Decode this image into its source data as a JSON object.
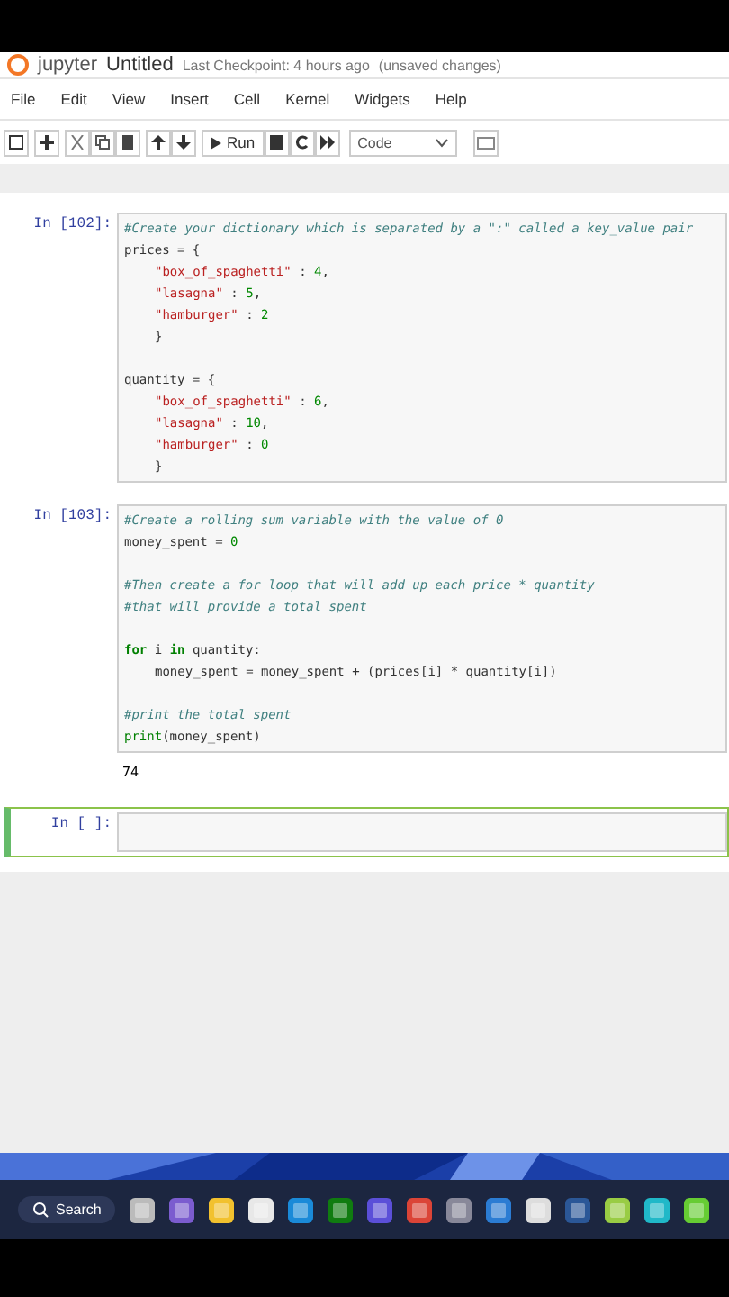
{
  "header": {
    "logo": "jupyter",
    "notebook_name": "Untitled",
    "checkpoint": "Last Checkpoint: 4 hours ago",
    "status": "(unsaved changes)"
  },
  "menu": [
    "File",
    "Edit",
    "View",
    "Insert",
    "Cell",
    "Kernel",
    "Widgets",
    "Help"
  ],
  "toolbar": {
    "run_label": "Run",
    "cell_type": "Code"
  },
  "cells": [
    {
      "prompt": "In [102]:",
      "selected": false,
      "lines": [
        {
          "kind": "code",
          "indent": false,
          "segments": [
            {
              "kind": "comment",
              "text": "#Create your dictionary which is separated by a \":\" called a key_value pair"
            }
          ]
        },
        {
          "kind": "code",
          "indent": false,
          "segments": [
            {
              "kind": "plain",
              "text": "prices = {"
            }
          ]
        },
        {
          "kind": "code",
          "indent": true,
          "segments": [
            {
              "kind": "string",
              "text": "\"box_of_spaghetti\""
            },
            {
              "kind": "plain",
              "text": " : "
            },
            {
              "kind": "number",
              "text": "4"
            },
            {
              "kind": "plain",
              "text": ","
            }
          ]
        },
        {
          "kind": "code",
          "indent": true,
          "segments": [
            {
              "kind": "string",
              "text": "\"lasagna\""
            },
            {
              "kind": "plain",
              "text": " : "
            },
            {
              "kind": "number",
              "text": "5"
            },
            {
              "kind": "plain",
              "text": ","
            }
          ]
        },
        {
          "kind": "code",
          "indent": true,
          "segments": [
            {
              "kind": "string",
              "text": "\"hamburger\""
            },
            {
              "kind": "plain",
              "text": " : "
            },
            {
              "kind": "number",
              "text": "2"
            }
          ]
        },
        {
          "kind": "code",
          "indent": true,
          "segments": [
            {
              "kind": "plain",
              "text": "}"
            }
          ]
        },
        {
          "kind": "blank"
        },
        {
          "kind": "code",
          "indent": false,
          "segments": [
            {
              "kind": "plain",
              "text": "quantity = {"
            }
          ]
        },
        {
          "kind": "code",
          "indent": true,
          "segments": [
            {
              "kind": "string",
              "text": "\"box_of_spaghetti\""
            },
            {
              "kind": "plain",
              "text": " : "
            },
            {
              "kind": "number",
              "text": "6"
            },
            {
              "kind": "plain",
              "text": ","
            }
          ]
        },
        {
          "kind": "code",
          "indent": true,
          "segments": [
            {
              "kind": "string",
              "text": "\"lasagna\""
            },
            {
              "kind": "plain",
              "text": " : "
            },
            {
              "kind": "number",
              "text": "10"
            },
            {
              "kind": "plain",
              "text": ","
            }
          ]
        },
        {
          "kind": "code",
          "indent": true,
          "segments": [
            {
              "kind": "string",
              "text": "\"hamburger\""
            },
            {
              "kind": "plain",
              "text": " : "
            },
            {
              "kind": "number",
              "text": "0"
            }
          ]
        },
        {
          "kind": "code",
          "indent": true,
          "segments": [
            {
              "kind": "plain",
              "text": "}"
            }
          ]
        }
      ]
    },
    {
      "prompt": "In [103]:",
      "selected": false,
      "lines": [
        {
          "kind": "code",
          "indent": false,
          "segments": [
            {
              "kind": "comment",
              "text": "#Create a rolling sum variable with the value of 0"
            }
          ]
        },
        {
          "kind": "code",
          "indent": false,
          "segments": [
            {
              "kind": "plain",
              "text": "money_spent = "
            },
            {
              "kind": "number",
              "text": "0"
            }
          ]
        },
        {
          "kind": "blank"
        },
        {
          "kind": "code",
          "indent": false,
          "segments": [
            {
              "kind": "comment",
              "text": "#Then create a for loop that will add up each price * quantity"
            }
          ]
        },
        {
          "kind": "code",
          "indent": false,
          "segments": [
            {
              "kind": "comment",
              "text": "#that will provide a total spent"
            }
          ]
        },
        {
          "kind": "blank"
        },
        {
          "kind": "code",
          "indent": false,
          "segments": [
            {
              "kind": "keyword",
              "text": "for"
            },
            {
              "kind": "plain",
              "text": " i "
            },
            {
              "kind": "keyword",
              "text": "in"
            },
            {
              "kind": "plain",
              "text": " quantity:"
            }
          ]
        },
        {
          "kind": "code",
          "indent": true,
          "segments": [
            {
              "kind": "plain",
              "text": "money_spent = money_spent + (prices[i] * quantity[i])"
            }
          ]
        },
        {
          "kind": "blank"
        },
        {
          "kind": "code",
          "indent": false,
          "segments": [
            {
              "kind": "comment",
              "text": "#print the total spent"
            }
          ]
        },
        {
          "kind": "code",
          "indent": false,
          "segments": [
            {
              "kind": "builtin",
              "text": "print"
            },
            {
              "kind": "plain",
              "text": "(money_spent)"
            }
          ]
        }
      ],
      "output": "74"
    },
    {
      "prompt": "In [ ]:",
      "selected": true
    }
  ],
  "taskbar": {
    "search": "Search"
  }
}
